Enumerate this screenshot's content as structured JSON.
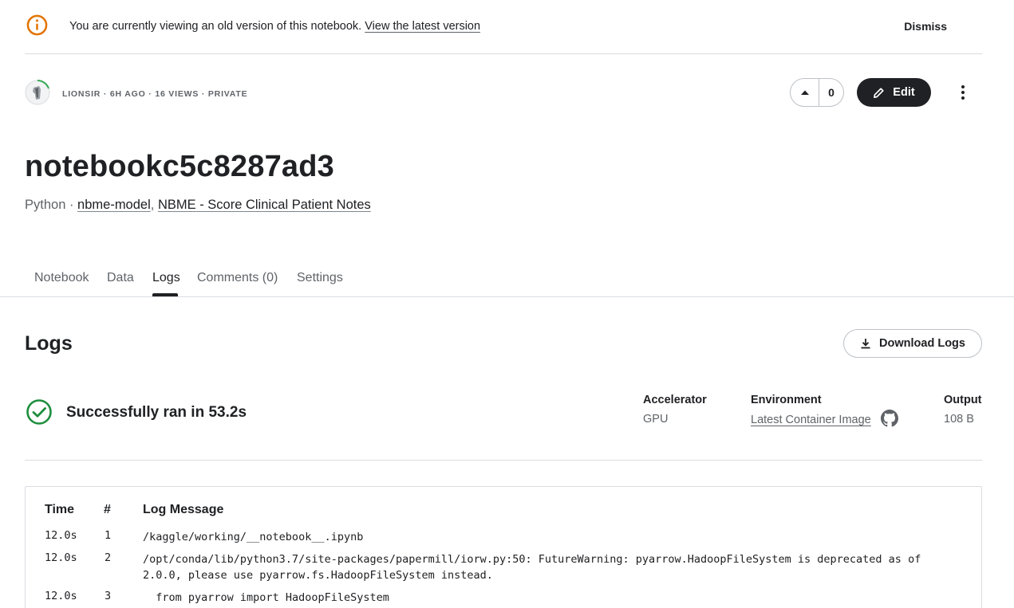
{
  "banner": {
    "message": "You are currently viewing an old version of this notebook.",
    "link_label": "View the latest version",
    "dismiss_label": "Dismiss"
  },
  "author": {
    "meta": "LIONSIR · 6H AGO · 16 VIEWS · PRIVATE"
  },
  "toolbar": {
    "vote_count": "0",
    "edit_label": "Edit"
  },
  "notebook": {
    "title": "notebookc5c8287ad3",
    "language": "Python · ",
    "source_1": "nbme-model",
    "separator": ", ",
    "source_2": "NBME - Score Clinical Patient Notes"
  },
  "tabs": [
    {
      "label": "Notebook"
    },
    {
      "label": "Data"
    },
    {
      "label": "Logs"
    },
    {
      "label": "Comments (0)"
    },
    {
      "label": "Settings"
    }
  ],
  "logs": {
    "heading": "Logs",
    "download_label": "Download Logs",
    "status": "Successfully ran in 53.2s",
    "accelerator_label": "Accelerator",
    "accelerator_value": "GPU",
    "environment_label": "Environment",
    "environment_value": "Latest Container Image",
    "output_label": "Output",
    "output_value": "108 B"
  },
  "log_table": {
    "headers": {
      "time": "Time",
      "num": "#",
      "message": "Log Message"
    },
    "rows": [
      {
        "time": "12.0s",
        "num": "1",
        "message": "/kaggle/working/__notebook__.ipynb"
      },
      {
        "time": "12.0s",
        "num": "2",
        "message": "/opt/conda/lib/python3.7/site-packages/papermill/iorw.py:50: FutureWarning: pyarrow.HadoopFileSystem is deprecated as of 2.0.0, please use pyarrow.fs.HadoopFileSystem instead."
      },
      {
        "time": "12.0s",
        "num": "3",
        "message": "  from pyarrow import HadoopFileSystem"
      }
    ]
  },
  "colors": {
    "info_icon": "#e37400",
    "success": "#1e8e3e",
    "primary_button": "#202124"
  },
  "icons": [
    "info-icon",
    "avatar",
    "arrow-up-icon",
    "pencil-icon",
    "more-vert-icon",
    "download-icon",
    "check-circle-icon",
    "github-icon"
  ]
}
